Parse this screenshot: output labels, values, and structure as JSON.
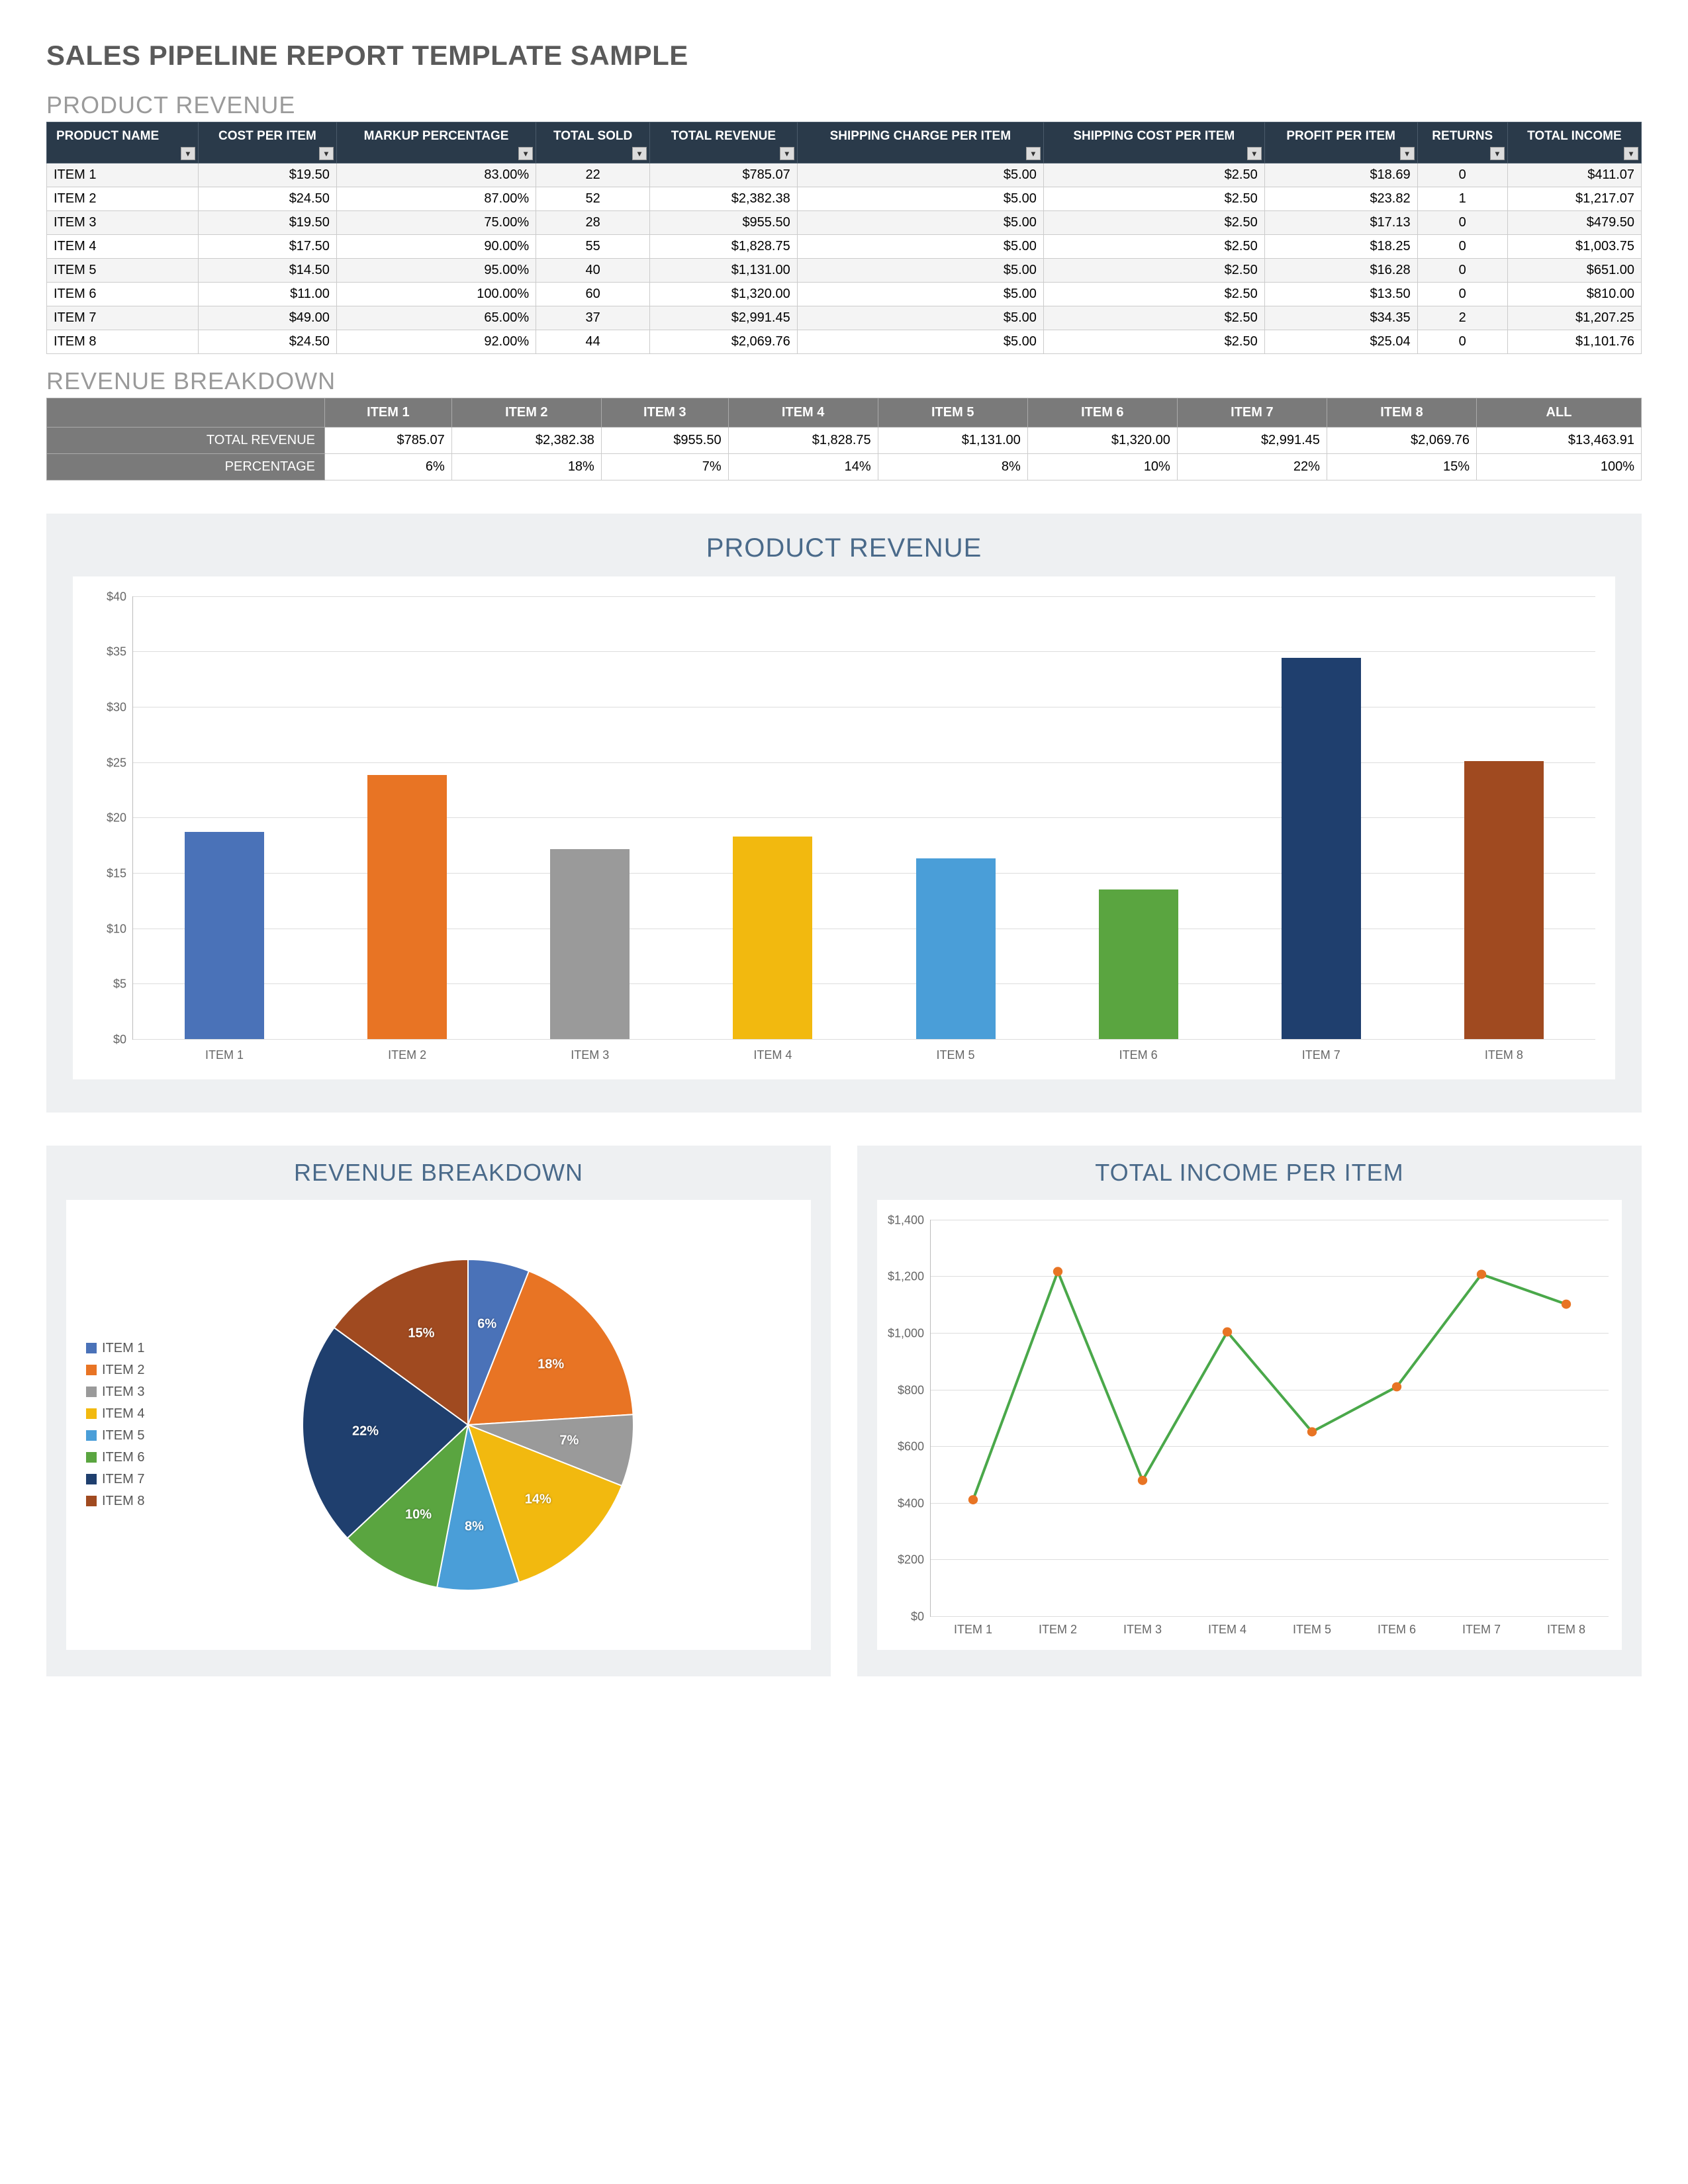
{
  "title": "SALES PIPELINE REPORT TEMPLATE SAMPLE",
  "sections": {
    "product_revenue": "PRODUCT REVENUE",
    "revenue_breakdown": "REVENUE BREAKDOWN",
    "chart_bar_title": "PRODUCT REVENUE",
    "chart_pie_title": "REVENUE BREAKDOWN",
    "chart_line_title": "TOTAL INCOME PER ITEM"
  },
  "colors": {
    "series": [
      "#4a72b8",
      "#e87424",
      "#9a9a9a",
      "#f2b90f",
      "#4a9ed8",
      "#5aa540",
      "#1f3f6e",
      "#a04a20"
    ]
  },
  "product_table": {
    "headers": [
      "PRODUCT NAME",
      "COST PER ITEM",
      "MARKUP PERCENTAGE",
      "TOTAL SOLD",
      "TOTAL REVENUE",
      "SHIPPING CHARGE PER ITEM",
      "SHIPPING COST PER ITEM",
      "PROFIT PER ITEM",
      "RETURNS",
      "TOTAL INCOME"
    ],
    "rows": [
      {
        "name": "ITEM 1",
        "cost": "$19.50",
        "markup": "83.00%",
        "sold": "22",
        "revenue": "$785.07",
        "ship_charge": "$5.00",
        "ship_cost": "$2.50",
        "profit": "$18.69",
        "returns": "0",
        "income": "$411.07"
      },
      {
        "name": "ITEM 2",
        "cost": "$24.50",
        "markup": "87.00%",
        "sold": "52",
        "revenue": "$2,382.38",
        "ship_charge": "$5.00",
        "ship_cost": "$2.50",
        "profit": "$23.82",
        "returns": "1",
        "income": "$1,217.07"
      },
      {
        "name": "ITEM 3",
        "cost": "$19.50",
        "markup": "75.00%",
        "sold": "28",
        "revenue": "$955.50",
        "ship_charge": "$5.00",
        "ship_cost": "$2.50",
        "profit": "$17.13",
        "returns": "0",
        "income": "$479.50"
      },
      {
        "name": "ITEM 4",
        "cost": "$17.50",
        "markup": "90.00%",
        "sold": "55",
        "revenue": "$1,828.75",
        "ship_charge": "$5.00",
        "ship_cost": "$2.50",
        "profit": "$18.25",
        "returns": "0",
        "income": "$1,003.75"
      },
      {
        "name": "ITEM 5",
        "cost": "$14.50",
        "markup": "95.00%",
        "sold": "40",
        "revenue": "$1,131.00",
        "ship_charge": "$5.00",
        "ship_cost": "$2.50",
        "profit": "$16.28",
        "returns": "0",
        "income": "$651.00"
      },
      {
        "name": "ITEM 6",
        "cost": "$11.00",
        "markup": "100.00%",
        "sold": "60",
        "revenue": "$1,320.00",
        "ship_charge": "$5.00",
        "ship_cost": "$2.50",
        "profit": "$13.50",
        "returns": "0",
        "income": "$810.00"
      },
      {
        "name": "ITEM 7",
        "cost": "$49.00",
        "markup": "65.00%",
        "sold": "37",
        "revenue": "$2,991.45",
        "ship_charge": "$5.00",
        "ship_cost": "$2.50",
        "profit": "$34.35",
        "returns": "2",
        "income": "$1,207.25"
      },
      {
        "name": "ITEM 8",
        "cost": "$24.50",
        "markup": "92.00%",
        "sold": "44",
        "revenue": "$2,069.76",
        "ship_charge": "$5.00",
        "ship_cost": "$2.50",
        "profit": "$25.04",
        "returns": "0",
        "income": "$1,101.76"
      }
    ]
  },
  "breakdown_table": {
    "col_headers": [
      "ITEM 1",
      "ITEM 2",
      "ITEM 3",
      "ITEM 4",
      "ITEM 5",
      "ITEM 6",
      "ITEM 7",
      "ITEM 8",
      "ALL"
    ],
    "rows": [
      {
        "label": "TOTAL REVENUE",
        "cells": [
          "$785.07",
          "$2,382.38",
          "$955.50",
          "$1,828.75",
          "$1,131.00",
          "$1,320.00",
          "$2,991.45",
          "$2,069.76",
          "$13,463.91"
        ]
      },
      {
        "label": "PERCENTAGE",
        "cells": [
          "6%",
          "18%",
          "7%",
          "14%",
          "8%",
          "10%",
          "22%",
          "15%",
          "100%"
        ]
      }
    ]
  },
  "chart_data": [
    {
      "id": "bar_product_revenue",
      "type": "bar",
      "title": "PRODUCT REVENUE",
      "categories": [
        "ITEM 1",
        "ITEM 2",
        "ITEM 3",
        "ITEM 4",
        "ITEM 5",
        "ITEM 6",
        "ITEM 7",
        "ITEM 8"
      ],
      "values": [
        18.69,
        23.82,
        17.13,
        18.25,
        16.28,
        13.5,
        34.35,
        25.04
      ],
      "colors_ref": "series",
      "ylabel_prefix": "$",
      "yticks": [
        0,
        5,
        10,
        15,
        20,
        25,
        30,
        35,
        40
      ],
      "ylim": [
        0,
        40
      ]
    },
    {
      "id": "pie_revenue_breakdown",
      "type": "pie",
      "title": "REVENUE BREAKDOWN",
      "categories": [
        "ITEM 1",
        "ITEM 2",
        "ITEM 3",
        "ITEM 4",
        "ITEM 5",
        "ITEM 6",
        "ITEM 7",
        "ITEM 8"
      ],
      "values": [
        6,
        18,
        7,
        14,
        8,
        10,
        22,
        15
      ],
      "labels": [
        "6%",
        "18%",
        "7%",
        "14%",
        "8%",
        "10%",
        "22%",
        "15%"
      ],
      "colors_ref": "series"
    },
    {
      "id": "line_total_income",
      "type": "line",
      "title": "TOTAL INCOME PER ITEM",
      "categories": [
        "ITEM 1",
        "ITEM 2",
        "ITEM 3",
        "ITEM 4",
        "ITEM 5",
        "ITEM 6",
        "ITEM 7",
        "ITEM 8"
      ],
      "values": [
        411.07,
        1217.07,
        479.5,
        1003.75,
        651.0,
        810.0,
        1207.25,
        1101.76
      ],
      "ylabel_prefix": "$",
      "yticks": [
        0,
        200,
        400,
        600,
        800,
        1000,
        1200,
        1400
      ],
      "ylim": [
        0,
        1400
      ],
      "line_color": "#4aa84a",
      "marker_color": "#e87424"
    }
  ]
}
